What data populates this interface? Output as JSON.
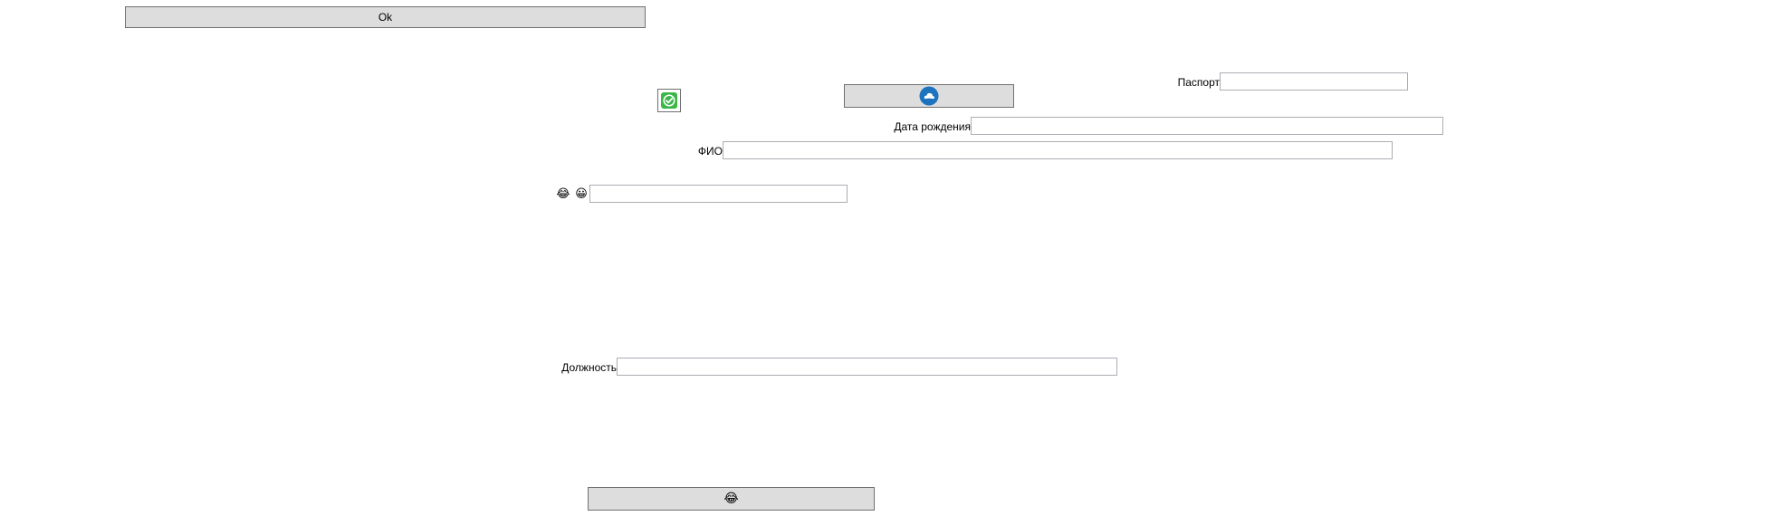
{
  "toolbar": {
    "ok_label": "Ok"
  },
  "form": {
    "passport": {
      "label": "Паспорт",
      "value": ""
    },
    "birth_date": {
      "label": "Дата рождения",
      "value": ""
    },
    "full_name": {
      "label": "ФИО",
      "value": ""
    },
    "position": {
      "label": "Должность",
      "value": ""
    },
    "emoji_field": {
      "value": ""
    }
  },
  "icons": {
    "check": "check-circle-icon",
    "cloud": "cloud-icon",
    "laugh_emoji": "😂",
    "grin_emoji": "😀",
    "bottom_button_emoji": "😂"
  },
  "colors": {
    "button_bg": "#dddddd",
    "check_green": "#3cb64a",
    "cloud_blue": "#1e73be"
  }
}
